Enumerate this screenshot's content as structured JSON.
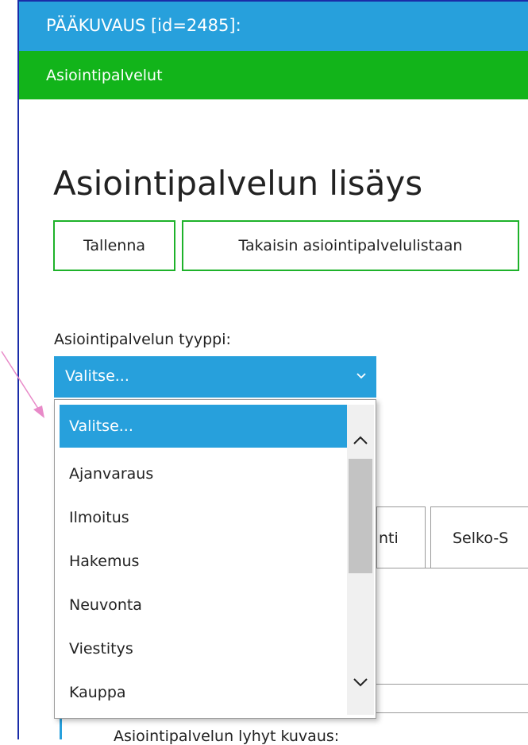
{
  "header": {
    "title": "PÄÄKUVAUS  [id=2485]:",
    "subtitle": "Asiointipalvelut"
  },
  "page": {
    "title": "Asiointipalvelun lisäys"
  },
  "toolbar": {
    "save_label": "Tallenna",
    "back_label": "Takaisin asiointipalvelulistaan"
  },
  "type_field": {
    "label": "Asiointipalvelun tyyppi:",
    "selected_value": "Valitse...",
    "options": [
      "Valitse...",
      "Ajanvaraus",
      "Ilmoitus",
      "Hakemus",
      "Neuvonta",
      "Viestitys",
      "Kauppa"
    ]
  },
  "tabs": {
    "tab_partial_1": "nti",
    "tab_partial_2": "Selko-S"
  },
  "bottom": {
    "label": "Asiointipalvelun lyhyt kuvaus:"
  },
  "colors": {
    "header_blue": "#27a0dc",
    "subbar_green": "#12b41a",
    "button_border_green": "#1eb22a",
    "annotation_pink": "#e88ac8"
  },
  "icons": {
    "select_chevron": "chevron-down-icon",
    "scroll_up": "chevron-up-icon",
    "scroll_down": "chevron-down-icon",
    "annotation": "arrow-icon"
  }
}
